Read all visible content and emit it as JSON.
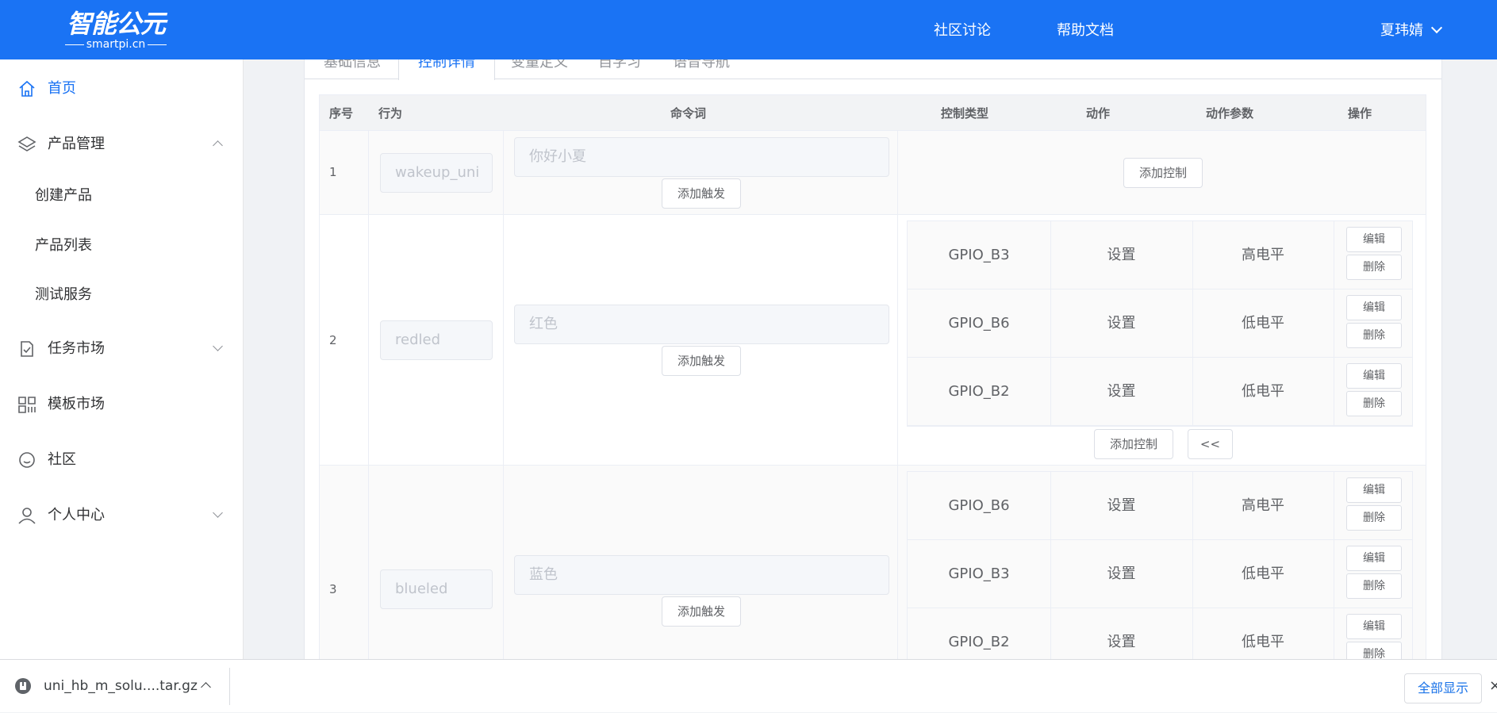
{
  "header": {
    "logo_text": "智能公元",
    "logo_sub": "smartpi.cn",
    "nav": [
      "社区讨论",
      "帮助文档"
    ],
    "user": "夏玮婧"
  },
  "sidebar": {
    "items": [
      {
        "label": "首页",
        "icon": "home-icon"
      },
      {
        "label": "产品管理",
        "icon": "layers-icon"
      },
      {
        "label": "创建产品"
      },
      {
        "label": "产品列表"
      },
      {
        "label": "测试服务"
      },
      {
        "label": "任务市场",
        "icon": "task-icon"
      },
      {
        "label": "模板市场",
        "icon": "grid-icon"
      },
      {
        "label": "社区",
        "icon": "smile-icon"
      },
      {
        "label": "个人中心",
        "icon": "user-icon"
      }
    ]
  },
  "tabs": [
    "基础信息",
    "控制详情",
    "变量定义",
    "自学习",
    "语音导航"
  ],
  "table": {
    "headers": [
      "序号",
      "行为",
      "命令词",
      "控制类型",
      "动作",
      "动作参数",
      "操作"
    ],
    "add_trigger": "添加触发",
    "add_control": "添加控制",
    "collapse": "<<",
    "edit": "编辑",
    "delete": "删除",
    "rows": [
      {
        "index": "1",
        "behavior": "wakeup_uni",
        "command": "你好小夏",
        "controls": []
      },
      {
        "index": "2",
        "behavior": "redled",
        "command": "红色",
        "controls": [
          {
            "type": "GPIO_B3",
            "action": "设置",
            "param": "高电平"
          },
          {
            "type": "GPIO_B6",
            "action": "设置",
            "param": "低电平"
          },
          {
            "type": "GPIO_B2",
            "action": "设置",
            "param": "低电平"
          }
        ]
      },
      {
        "index": "3",
        "behavior": "blueled",
        "command": "蓝色",
        "controls": [
          {
            "type": "GPIO_B6",
            "action": "设置",
            "param": "高电平"
          },
          {
            "type": "GPIO_B3",
            "action": "设置",
            "param": "低电平"
          },
          {
            "type": "GPIO_B2",
            "action": "设置",
            "param": "低电平"
          }
        ]
      }
    ]
  },
  "download_bar": {
    "file": "uni_hb_m_solu....tar.gz",
    "show_all": "全部显示",
    "close": "×"
  },
  "colors": {
    "primary": "#1a73f4",
    "sidebar_active": "#1a73f4"
  }
}
